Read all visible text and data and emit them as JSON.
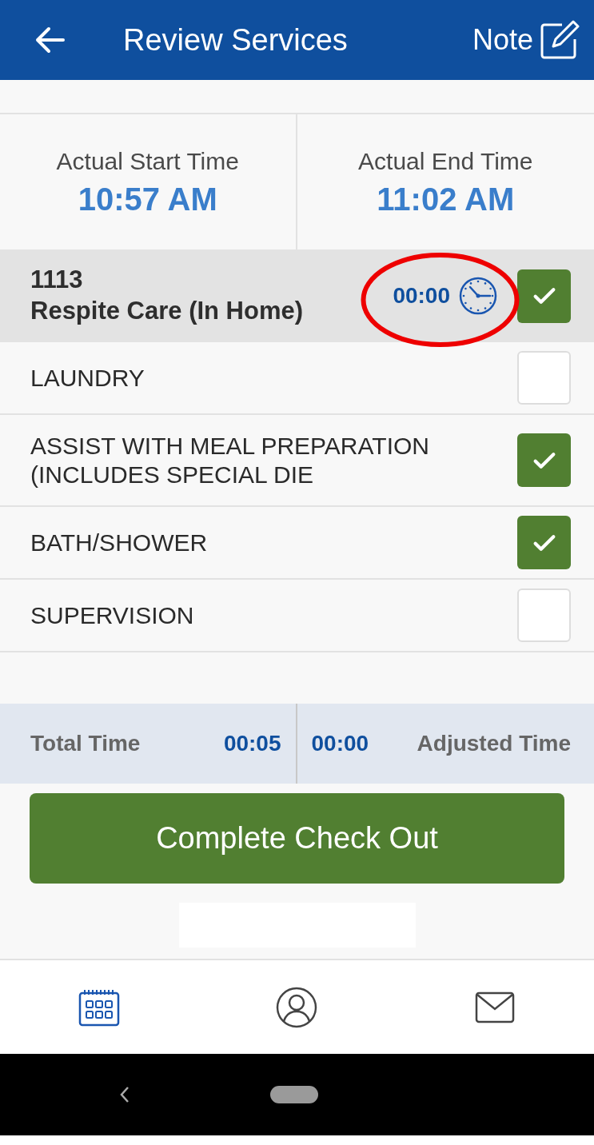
{
  "header": {
    "title": "Review Services",
    "note_label": "Note"
  },
  "times": [
    {
      "label": "Actual Start Time",
      "value": "10:57 AM"
    },
    {
      "label": "Actual End Time",
      "value": "11:02 AM"
    }
  ],
  "service": {
    "code": "1113",
    "name": "Respite Care (In Home)",
    "duration": "00:00",
    "checked": true
  },
  "tasks": [
    {
      "label": "LAUNDRY",
      "checked": false
    },
    {
      "label": "ASSIST WITH MEAL PREPARATION (INCLUDES SPECIAL DIE",
      "checked": true
    },
    {
      "label": "BATH/SHOWER",
      "checked": true
    },
    {
      "label": "SUPERVISION",
      "checked": false
    }
  ],
  "totals": {
    "total_label": "Total Time",
    "total_value": "00:05",
    "adjusted_value": "00:00",
    "adjusted_label": "Adjusted Time"
  },
  "primary_button": "Complete Check Out",
  "bottom_nav": [
    {
      "kind": "calendar",
      "selected": true
    },
    {
      "kind": "profile",
      "selected": false
    },
    {
      "kind": "mail",
      "selected": false
    }
  ]
}
